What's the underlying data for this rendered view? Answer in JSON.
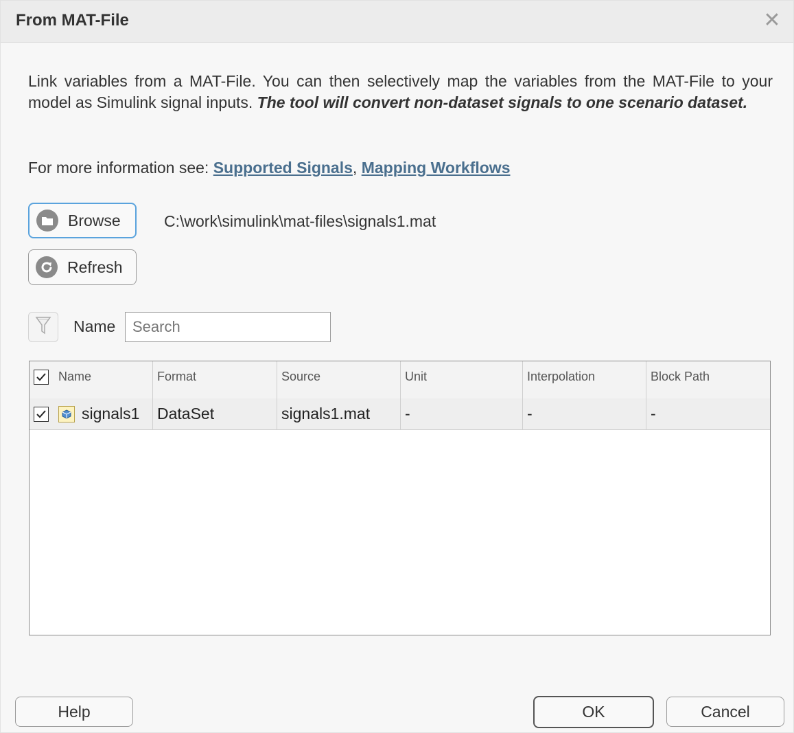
{
  "dialog": {
    "title": "From MAT-File",
    "close_glyph": "✕"
  },
  "description": {
    "text": "Link variables from a MAT-File. You can then selectively map the variables from the MAT-File to your model as Simulink signal inputs. ",
    "bold_text": "The tool will convert non-dataset signals to one scenario dataset."
  },
  "more_info": {
    "prefix": "For more information see: ",
    "link1": "Supported Signals",
    "separator": ", ",
    "link2": "Mapping Workflows",
    "link_color": "#4a6f8e"
  },
  "browse": {
    "label": "Browse",
    "icon": "folder-icon"
  },
  "refresh": {
    "label": "Refresh",
    "icon": "refresh-icon"
  },
  "file_path": "C:\\work\\simulink\\mat-files\\signals1.mat",
  "filter": {
    "icon": "filter-icon",
    "name_label": "Name",
    "search_placeholder": "Search",
    "search_value": ""
  },
  "table": {
    "columns": [
      "Name",
      "Format",
      "Source",
      "Unit",
      "Interpolation",
      "Block Path"
    ],
    "header_checked": true,
    "rows": [
      {
        "checked": true,
        "icon": "dataset-icon",
        "name": "signals1",
        "format": "DataSet",
        "source": "signals1.mat",
        "unit": "-",
        "interpolation": "-",
        "block_path": "-"
      }
    ]
  },
  "footer": {
    "help_label": "Help",
    "ok_label": "OK",
    "cancel_label": "Cancel"
  },
  "colors": {
    "accent_focus": "#5aa3dd",
    "title_bar": "#ececec",
    "dialog_bg": "#f7f7f7"
  }
}
